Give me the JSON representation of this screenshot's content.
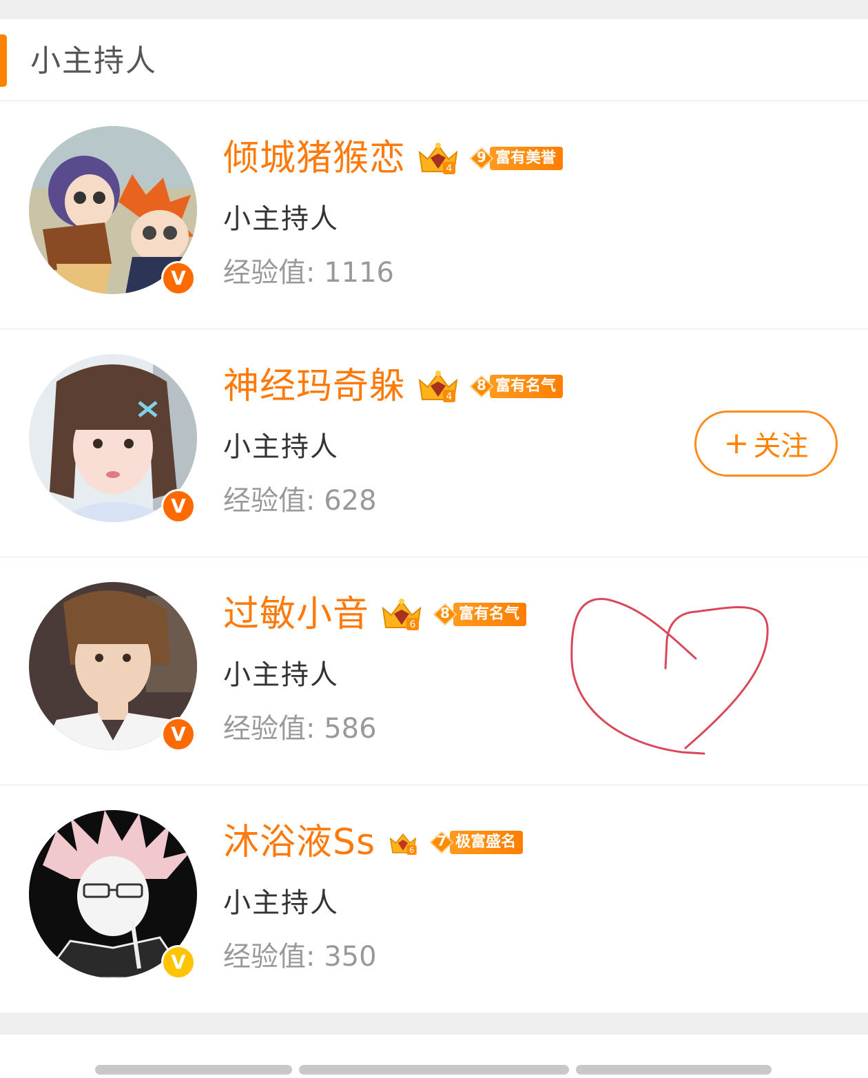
{
  "section": {
    "title": "小主持人"
  },
  "users": [
    {
      "name": "倾城猪猴恋",
      "crown_level": "4",
      "rep_level": "9",
      "rep_title": "富有美誉",
      "role": "小主持人",
      "exp": "经验值: 1116",
      "verified_color": "#ff6a00",
      "avatar_theme": "anime-duo"
    },
    {
      "name": "神经玛奇躲",
      "crown_level": "4",
      "rep_level": "8",
      "rep_title": "富有名气",
      "role": "小主持人",
      "exp": "经验值: 628",
      "verified_color": "#ff6a00",
      "avatar_theme": "girl-portrait",
      "follow_label": "关注"
    },
    {
      "name": "过敏小音",
      "crown_level": "6",
      "rep_level": "8",
      "rep_title": "富有名气",
      "role": "小主持人",
      "exp": "经验值: 586",
      "verified_color": "#ff6a00",
      "avatar_theme": "boy-portrait"
    },
    {
      "name": "沐浴液Ss",
      "crown_level": "6",
      "rep_level": "7",
      "rep_title": "极富盛名",
      "role": "小主持人",
      "exp": "经验值: 350",
      "verified_color": "#ffc400",
      "avatar_theme": "anime-glasses"
    }
  ],
  "colors": {
    "accent": "#ff8200",
    "name": "#ff7a0a",
    "heart": "#d9475a"
  },
  "icons": {
    "verified": "V",
    "follow_plus": "+"
  }
}
